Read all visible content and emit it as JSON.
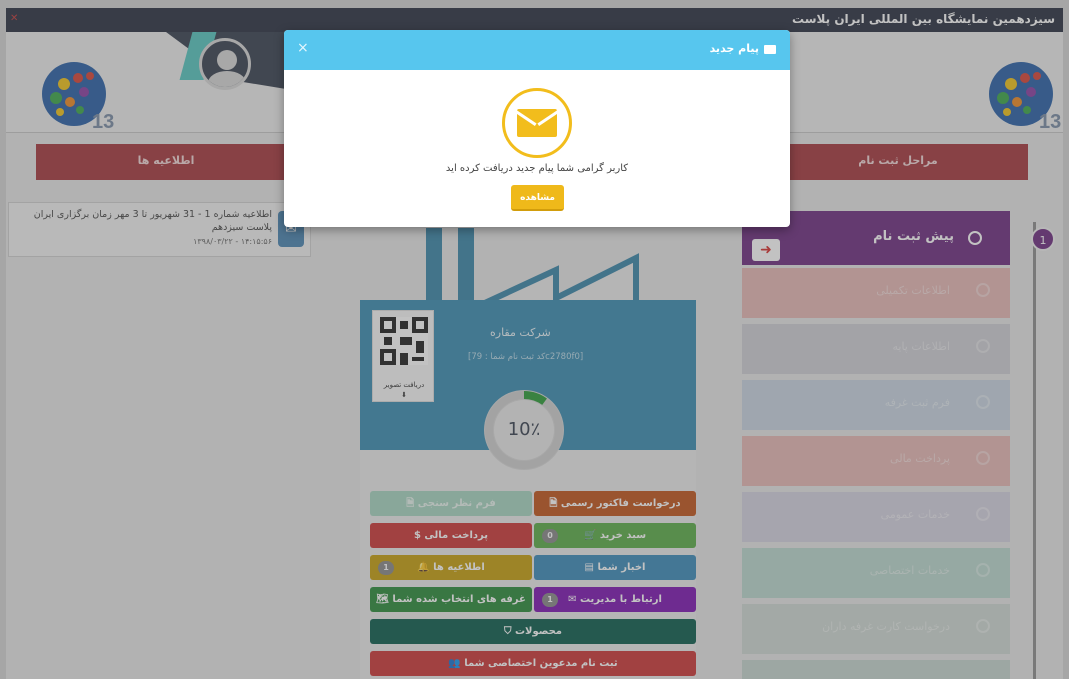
{
  "topbar": {
    "title": "سیزدهمین نمایشگاه بین المللی ایران پلاست"
  },
  "header": {
    "logo_number": "13"
  },
  "tabs": {
    "news_label": "اطلاعیه ها",
    "registration_steps_label": "مراحل ثبت نام"
  },
  "news": {
    "items": [
      {
        "text": "اطلاعیه شماره 1 - 31 شهریور تا 3 مهر زمان برگزاری ایران پلاست سیزدهم",
        "date": "۱۳۹۸/۰۳/۲۲ - ۱۴:۱۵:۵۶"
      }
    ]
  },
  "company": {
    "name": "شرکت مقاره",
    "code_line": "[کد ثبت نام شما : 79c2780f0]",
    "qr_caption": "دریافت تصویر",
    "progress_percent": 10,
    "progress_label": "10٪"
  },
  "actions": {
    "invoice_request": "درخواست فاکتور رسمی",
    "form_survey": "فرم نظر سنجی",
    "cart": "سبد خرید",
    "cart_count": "0",
    "payment": "پرداخت مالی",
    "your_news": "اخبار شما",
    "announcements": "اطلاعیه ها",
    "announcements_count": "1",
    "contact_admin": "ارتباط با مدیریت",
    "contact_admin_count": "1",
    "selected_booths": "غرفه های انتخاب شده شما",
    "products": "محصولات",
    "invitees_registration": "ثبت نام مدعوین اختصاصی شما"
  },
  "steps": {
    "current_number": "1",
    "items": [
      {
        "label": "پیش ثبت نام"
      },
      {
        "label": "اطلاعات تکمیلی"
      },
      {
        "label": "اطلاعات پایه"
      },
      {
        "label": "فرم ثبت غرفه"
      },
      {
        "label": "پرداخت مالی"
      },
      {
        "label": "خدمات عمومی"
      },
      {
        "label": "خدمات اختصاصی"
      },
      {
        "label": "درخواست کارت غرفه داران"
      }
    ]
  },
  "modal": {
    "title": "پیام جدید",
    "close_symbol": "×",
    "message": "کاربر گرامی شما پیام جدید دریافت کرده اید",
    "view_button": "مشاهده"
  },
  "colors": {
    "modal_header": "#57c6ee",
    "accent_yellow": "#efb91a",
    "tab_red": "#a63a40",
    "step_purple": "#6f2f82",
    "panel_blue": "#3d8eb2"
  }
}
